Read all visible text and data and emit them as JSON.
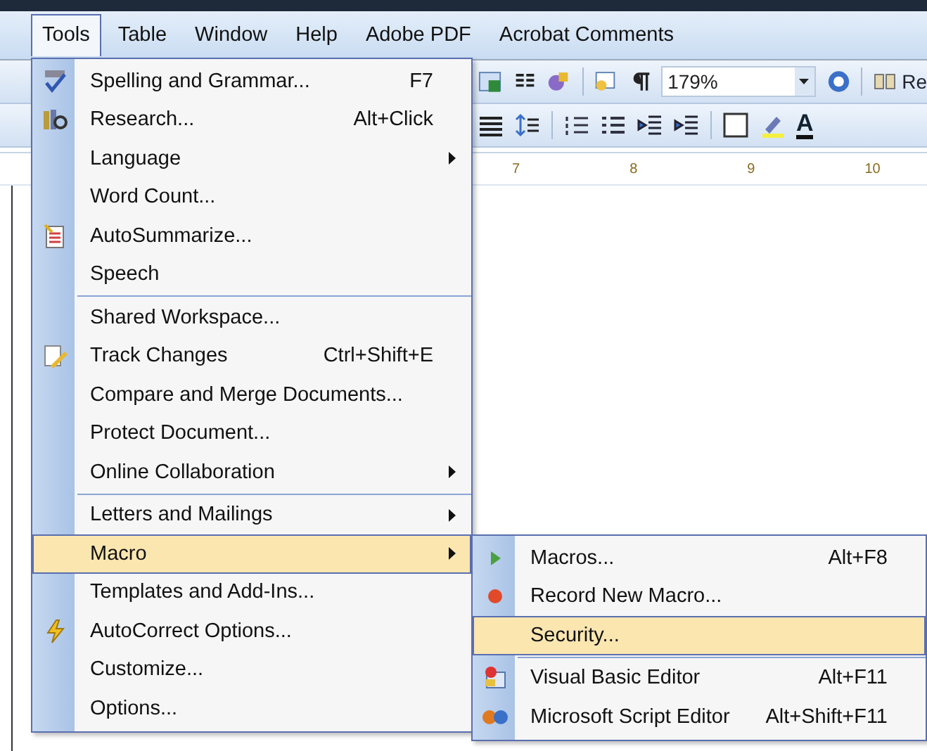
{
  "menubar": [
    {
      "label": "Tools",
      "selected": true
    },
    {
      "label": "Table",
      "selected": false
    },
    {
      "label": "Window",
      "selected": false
    },
    {
      "label": "Help",
      "selected": false
    },
    {
      "label": "Adobe PDF",
      "selected": false
    },
    {
      "label": "Acrobat Comments",
      "selected": false
    }
  ],
  "toolbar": {
    "zoom": "179%",
    "read_label": "Re",
    "font_color_letter": "A"
  },
  "ruler": [
    "7",
    "8",
    "9",
    "10"
  ],
  "tools_menu": {
    "groups": [
      [
        {
          "label": "Spelling and Grammar...",
          "shortcut": "F7",
          "kind": "spelling",
          "submenu": false,
          "selected": false
        },
        {
          "label": "Research...",
          "shortcut": "Alt+Click",
          "kind": "research",
          "submenu": false,
          "selected": false
        },
        {
          "label": "Language",
          "kind": "plain",
          "submenu": true,
          "selected": false
        },
        {
          "label": "Word Count...",
          "kind": "plain",
          "submenu": false,
          "selected": false
        },
        {
          "label": "AutoSummarize...",
          "kind": "summarize",
          "submenu": false,
          "selected": false
        },
        {
          "label": "Speech",
          "kind": "plain",
          "submenu": false,
          "selected": false
        }
      ],
      [
        {
          "label": "Shared Workspace...",
          "kind": "plain",
          "submenu": false,
          "selected": false
        },
        {
          "label": "Track Changes",
          "shortcut": "Ctrl+Shift+E",
          "kind": "track",
          "submenu": false,
          "selected": false
        },
        {
          "label": "Compare and Merge Documents...",
          "kind": "plain",
          "submenu": false,
          "selected": false
        },
        {
          "label": "Protect Document...",
          "kind": "plain",
          "submenu": false,
          "selected": false
        },
        {
          "label": "Online Collaboration",
          "kind": "plain",
          "submenu": true,
          "selected": false
        }
      ],
      [
        {
          "label": "Letters and Mailings",
          "kind": "plain",
          "submenu": true,
          "selected": false
        },
        {
          "label": "Macro",
          "kind": "plain",
          "submenu": true,
          "selected": true
        },
        {
          "label": "Templates and Add-Ins...",
          "kind": "plain",
          "submenu": false,
          "selected": false
        },
        {
          "label": "AutoCorrect Options...",
          "kind": "lightning",
          "submenu": false,
          "selected": false
        },
        {
          "label": "Customize...",
          "kind": "plain",
          "submenu": false,
          "selected": false
        },
        {
          "label": "Options...",
          "kind": "plain",
          "submenu": false,
          "selected": false
        }
      ]
    ]
  },
  "macro_submenu": {
    "groups": [
      [
        {
          "label": "Macros...",
          "shortcut": "Alt+F8",
          "kind": "play",
          "selected": false
        },
        {
          "label": "Record New Macro...",
          "kind": "record",
          "selected": false
        },
        {
          "label": "Security...",
          "kind": "plain",
          "selected": true
        }
      ],
      [
        {
          "label": "Visual Basic Editor",
          "shortcut": "Alt+F11",
          "kind": "vbe",
          "selected": false
        },
        {
          "label": "Microsoft Script Editor",
          "shortcut": "Alt+Shift+F11",
          "kind": "script",
          "selected": false
        }
      ]
    ]
  }
}
